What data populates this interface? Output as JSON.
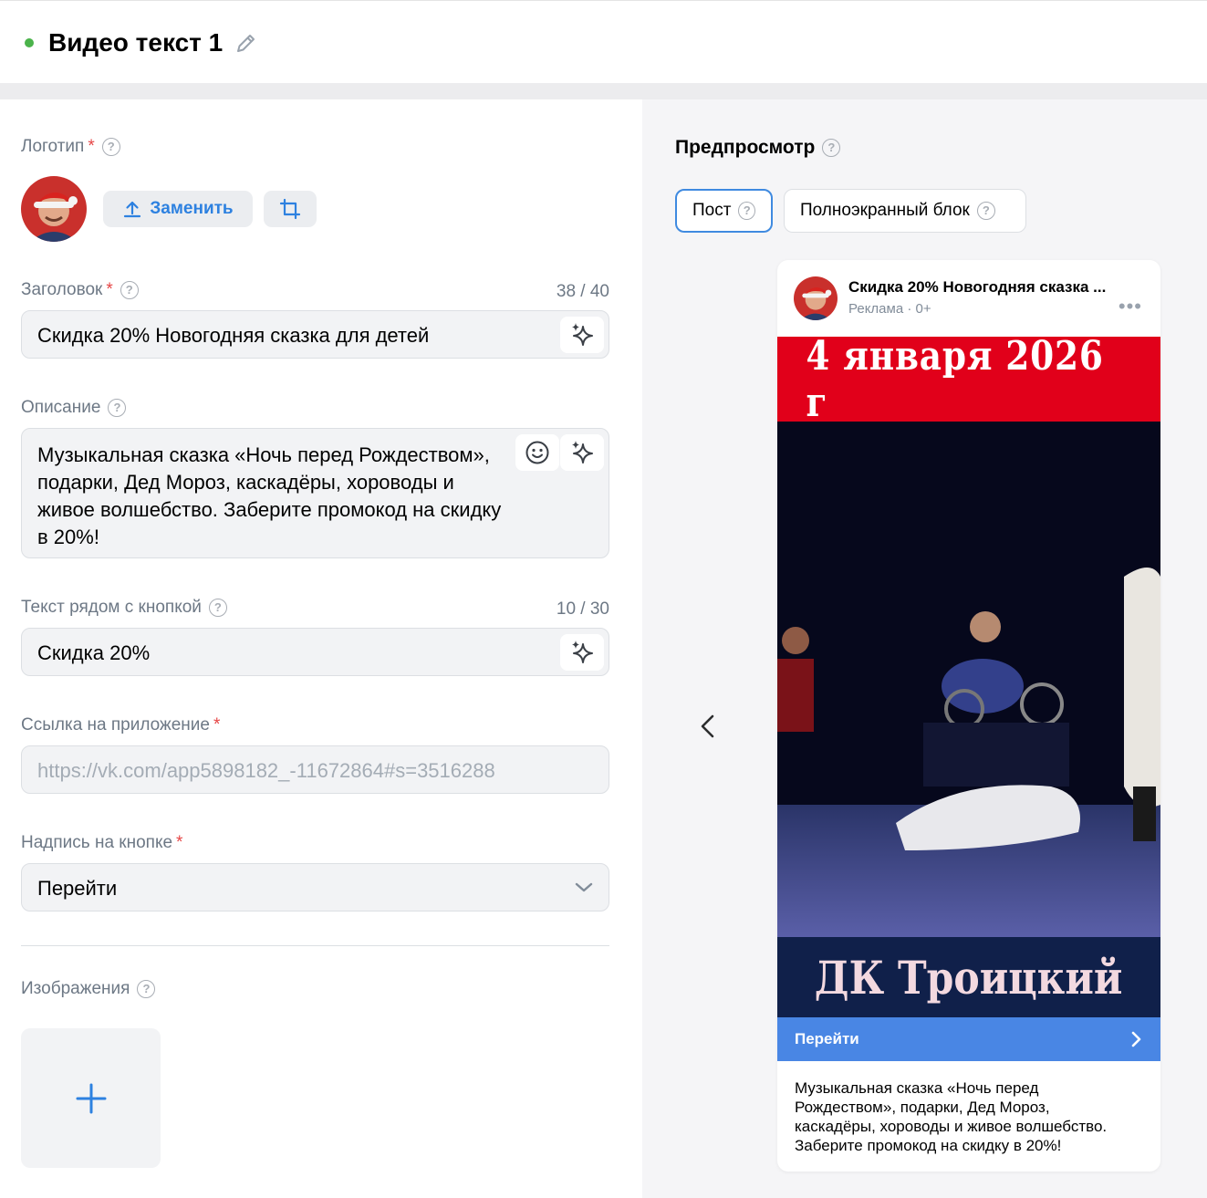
{
  "header": {
    "title": "Видео текст 1",
    "status_color": "#4bb34b"
  },
  "form": {
    "logo": {
      "label": "Логотип",
      "replace_label": "Заменить"
    },
    "headline": {
      "label": "Заголовок",
      "counter": "38 / 40",
      "value": "Скидка 20% Новогодняя сказка для детей"
    },
    "description": {
      "label": "Описание",
      "lines": [
        "Музыкальная сказка «Ночь перед Рождеством»,",
        "подарки, Дед Мороз, каскадёры, хороводы и",
        "живое волшебство. Заберите промокод на скидку",
        "в 20%!"
      ]
    },
    "button_text": {
      "label": "Текст рядом с кнопкой",
      "counter": "10 / 30",
      "value": "Скидка 20%"
    },
    "app_link": {
      "label": "Ссылка на приложение",
      "placeholder": "https://vk.com/app5898182_-11672864#s=3516288"
    },
    "button_caption": {
      "label": "Надпись на кнопке",
      "value": "Перейти"
    },
    "images": {
      "label": "Изображения"
    }
  },
  "preview": {
    "title": "Предпросмотр",
    "tabs": [
      {
        "label": "Пост",
        "active": true
      },
      {
        "label": "Полноэкранный блок",
        "active": false
      }
    ],
    "card": {
      "name": "Скидка 20% Новогодняя сказка ...",
      "sub": "Реклама · 0+",
      "media_top": "4 января 2026 г",
      "media_bottom": "ДК Троицкий",
      "cta": "Перейти",
      "description_lines": [
        "Музыкальная сказка «Ночь перед",
        "Рождеством», подарки, Дед Мороз,",
        "каскадёры, хороводы и живое волшебство.",
        "Заберите промокод на скидку в 20%!"
      ]
    }
  },
  "colors": {
    "accent": "#2d81e0",
    "cta": "#4986e4",
    "required": "#e64646"
  }
}
